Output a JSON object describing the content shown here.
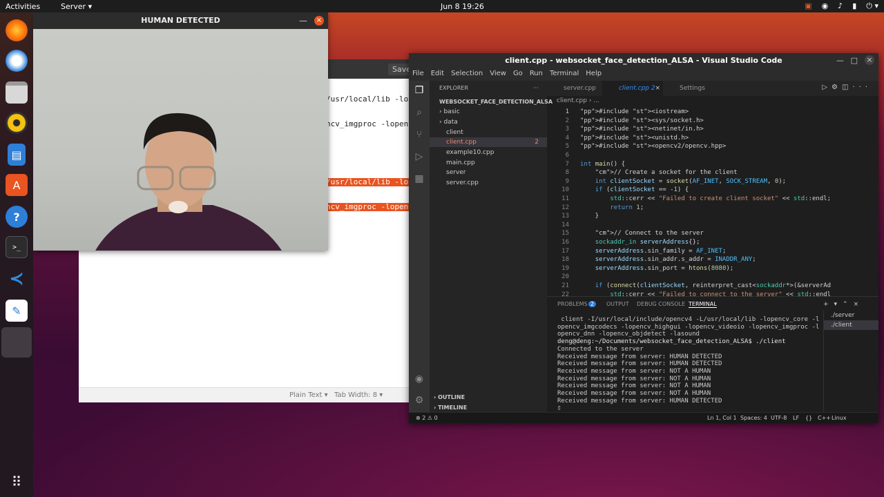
{
  "topbar": {
    "activities": "Activities",
    "app_menu": "Server ▾",
    "clock": "Jun 8  19:26",
    "tray": [
      "▣",
      "◉",
      "♪",
      "▮",
      "⏻ ▾"
    ]
  },
  "dock": {
    "icons": [
      "firefox-icon",
      "thunderbird-icon",
      "files-icon",
      "rhythmbox-icon",
      "writer-icon",
      "software-icon",
      "help-icon",
      "terminal-icon",
      "vscode-icon",
      "editor-icon",
      "blank-icon",
      "show-apps-icon"
    ]
  },
  "gedit": {
    "save": "Save",
    "code_lines": [
      "/usr/local/lib -lope",
      "ncv_imgproc -lopencv",
      "",
      "",
      "/usr/local/lib -loper",
      "ncv_imgproc -lopencv"
    ],
    "status": {
      "plain": "Plain Text ▾",
      "tab": "Tab Width: 8 ▾"
    }
  },
  "camera": {
    "title": "HUMAN DETECTED",
    "minimize": "—",
    "close": "×"
  },
  "vscode": {
    "title": "client.cpp - websocket_face_detection_ALSA - Visual Studio Code",
    "win_controls": [
      "—",
      "□",
      "×"
    ],
    "menu": [
      "File",
      "Edit",
      "Selection",
      "View",
      "Go",
      "Run",
      "Terminal",
      "Help"
    ],
    "explorer_header": "EXPLORER",
    "explorer_more": "···",
    "folder": "WEBSOCKET_FACE_DETECTION_ALSA",
    "tree": [
      {
        "label": "› basic"
      },
      {
        "label": "› data"
      },
      {
        "label": "client"
      },
      {
        "label": "client.cpp",
        "badge": "2"
      },
      {
        "label": "example10.cpp"
      },
      {
        "label": "main.cpp"
      },
      {
        "label": "server"
      },
      {
        "label": "server.cpp"
      }
    ],
    "outline": "› OUTLINE",
    "timeline": "› TIMELINE",
    "tabs": [
      {
        "label": "server.cpp"
      },
      {
        "label": "client.cpp 2"
      },
      {
        "label": "Settings"
      }
    ],
    "breadcrumb": "client.cpp › ...",
    "line_numbers": [
      "1",
      "2",
      "3",
      "4",
      "5",
      "6",
      "7",
      "8",
      "9",
      "10",
      "11",
      "12",
      "13",
      "14",
      "15",
      "16",
      "17",
      "18",
      "19",
      "20",
      "21",
      "22"
    ],
    "code": [
      "#include <iostream>",
      "#include <sys/socket.h>",
      "#include <netinet/in.h>",
      "#include <unistd.h>",
      "#include <opencv2/opencv.hpp>",
      "",
      "int main() {",
      "    // Create a socket for the client",
      "    int clientSocket = socket(AF_INET, SOCK_STREAM, 0);",
      "    if (clientSocket == -1) {",
      "        std::cerr << \"Failed to create client socket\" << std::endl;",
      "        return 1;",
      "    }",
      "",
      "    // Connect to the server",
      "    sockaddr_in serverAddress{};",
      "    serverAddress.sin_family = AF_INET;",
      "    serverAddress.sin_addr.s_addr = INADDR_ANY;",
      "    serverAddress.sin_port = htons(8080);",
      "",
      "    if (connect(clientSocket, reinterpret_cast<sockaddr*>(&serverAd",
      "        std::cerr << \"Failed to connect to the server\" << std::endl"
    ],
    "panel_tabs": [
      "PROBLEMS",
      "OUTPUT",
      "DEBUG CONSOLE",
      "TERMINAL"
    ],
    "problems_badge": "2",
    "terminal": [
      " client -I/usr/local/include/opencv4 -L/usr/local/lib -lopencv_core -l",
      "opencv_imgcodecs -lopencv_highgui -lopencv_videoio -lopencv_imgproc -l",
      "opencv_dnn -lopencv_objdetect -lasound",
      "deng@deng:~/Documents/websocket_face_detection_ALSA$ ./client",
      "Connected to the server",
      "Received message from server: HUMAN DETECTED",
      "Received message from server: HUMAN DETECTED",
      "Received message from server: NOT A HUMAN",
      "Received message from server: NOT A HUMAN",
      "Received message from server: NOT A HUMAN",
      "Received message from server: NOT A HUMAN",
      "Received message from server: HUMAN DETECTED",
      "▯"
    ],
    "terminal_list": [
      "./server",
      "./client"
    ],
    "statusbar": {
      "left": "⊗ 2 ⚠ 0",
      "pos": "Ln 1, Col 1",
      "spaces": "Spaces: 4",
      "enc": "UTF-8",
      "eol": "LF",
      "braces": "{}",
      "lang": "C++",
      "os": "Linux"
    }
  }
}
